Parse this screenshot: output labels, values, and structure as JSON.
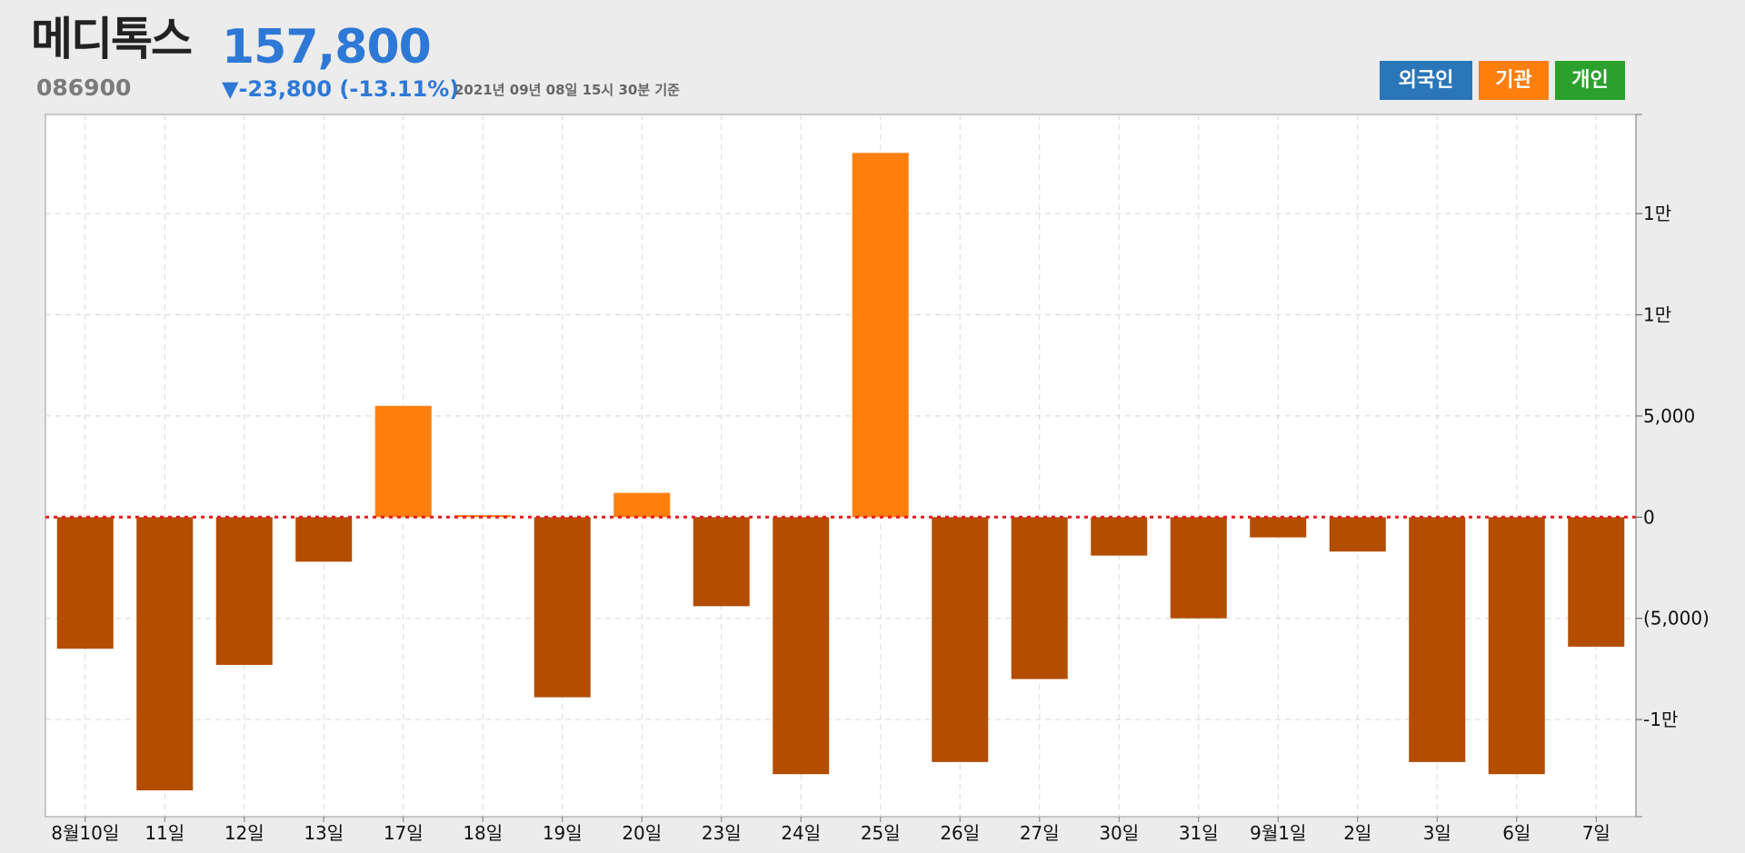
{
  "header": {
    "stock_name": "메디톡스",
    "stock_code": "086900",
    "price": "157,800",
    "change": "▼-23,800 (-13.11%)",
    "as_of": "2021년 09년 08일 15시 30분 기준"
  },
  "legend": {
    "foreign": "외국인",
    "institution": "기관",
    "individual": "개인"
  },
  "colors": {
    "positive_bar": "#ff7f0e",
    "negative_bar": "#b34d00",
    "zero_line": "#e8191f",
    "grid": "#d8d8d8",
    "price_text": "#2e78d6"
  },
  "chart_data": {
    "type": "bar",
    "series": [
      {
        "name": "기관",
        "values": [
          -6500,
          -13500,
          -7300,
          -2200,
          5500,
          100,
          -8900,
          1200,
          -4400,
          -12700,
          18000,
          -12100,
          -8000,
          -1900,
          -5000,
          -1000,
          -1700,
          -12100,
          -12700,
          -6400
        ]
      }
    ],
    "categories": [
      "8월10일",
      "11일",
      "12일",
      "13일",
      "17일",
      "18일",
      "19일",
      "20일",
      "23일",
      "24일",
      "25일",
      "26일",
      "27일",
      "30일",
      "31일",
      "9월1일",
      "2일",
      "3일",
      "6일",
      "7일"
    ],
    "y_ticks": [
      {
        "value": 15000,
        "label": "1만"
      },
      {
        "value": 10000,
        "label": "1만"
      },
      {
        "value": 5000,
        "label": "5,000"
      },
      {
        "value": 0,
        "label": "0"
      },
      {
        "value": -5000,
        "label": "(5,000)"
      },
      {
        "value": -10000,
        "label": "-1만"
      }
    ],
    "ylim": [
      -14800,
      19900
    ],
    "grid": true,
    "zero_line": "dotted"
  }
}
